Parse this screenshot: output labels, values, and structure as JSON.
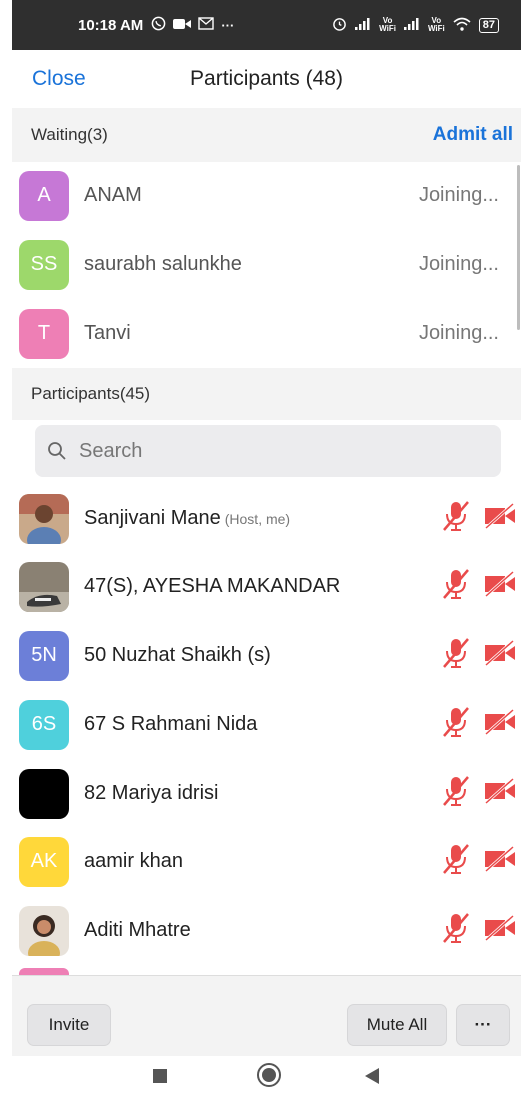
{
  "status_bar": {
    "time": "10:18 AM",
    "icons_left": [
      "whatsapp-icon",
      "video-icon",
      "gmail-icon",
      "more-dots-icon"
    ],
    "icons_right": [
      "alarm-icon",
      "signal-icon",
      "vowifi-icon",
      "signal-icon",
      "vowifi-icon",
      "wifi-icon"
    ],
    "battery": "87"
  },
  "header": {
    "close_label": "Close",
    "title": "Participants (48)"
  },
  "waiting": {
    "label": "Waiting(3)",
    "admit_all_label": "Admit all",
    "items": [
      {
        "initials": "A",
        "name": "ANAM",
        "status": "Joining...",
        "color": "#c678d6"
      },
      {
        "initials": "SS",
        "name": "saurabh salunkhe",
        "status": "Joining...",
        "color": "#9dd86b"
      },
      {
        "initials": "T",
        "name": "Tanvi",
        "status": "Joining...",
        "color": "#ee7fb5"
      }
    ]
  },
  "participants": {
    "label": "Participants(45)",
    "search_placeholder": "Search",
    "items": [
      {
        "initials": "",
        "name": "Sanjivani Mane",
        "tag": "(Host, me)",
        "avatar": "photo"
      },
      {
        "initials": "",
        "name": "47(S), AYESHA MAKANDAR",
        "tag": "",
        "avatar": "photo"
      },
      {
        "initials": "5N",
        "name": "50 Nuzhat Shaikh (s)",
        "tag": "",
        "color": "#6c7fd8"
      },
      {
        "initials": "6S",
        "name": "67 S Rahmani Nida",
        "tag": "",
        "color": "#4fd0dc"
      },
      {
        "initials": "",
        "name": "82 Mariya idrisi",
        "tag": "",
        "color": "#000000"
      },
      {
        "initials": "AK",
        "name": "aamir khan",
        "tag": "",
        "color": "#ffd83a"
      },
      {
        "initials": "",
        "name": "Aditi Mhatre",
        "tag": "",
        "avatar": "photo"
      }
    ]
  },
  "footer": {
    "invite_label": "Invite",
    "mute_all_label": "Mute All",
    "more_label": "···"
  },
  "colors": {
    "accent": "#1a73d9",
    "muted_red": "#e94b4b",
    "header_bg": "#f3f3f3"
  }
}
